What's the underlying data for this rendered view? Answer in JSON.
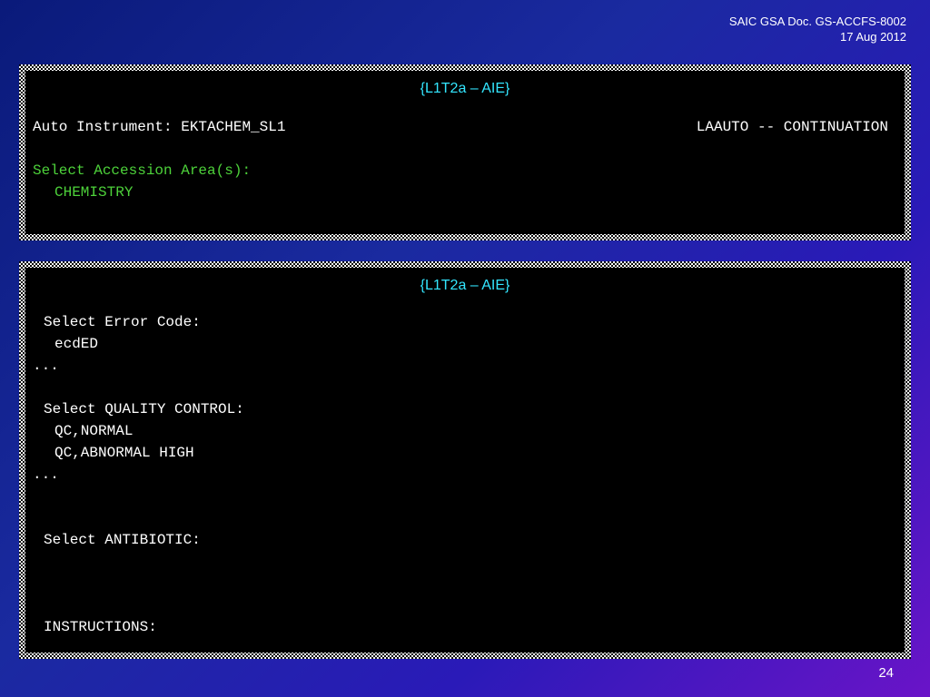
{
  "header": {
    "doc_id": "SAIC GSA Doc. GS-ACCFS-8002",
    "date": "17 Aug 2012"
  },
  "panel_top": {
    "title": "{L1T2a – AIE}",
    "instrument_line": "Auto Instrument: EKTACHEM_SL1",
    "mode_label": "LAAUTO -- CONTINUATION",
    "accession_prompt": "Select Accession Area(s):",
    "accession_value": "CHEMISTRY"
  },
  "panel_bottom": {
    "title": "{L1T2a – AIE}",
    "error_prompt": "Select Error Code:",
    "error_value": "ecdED",
    "ellipsis_1": "...",
    "qc_prompt": "Select QUALITY CONTROL:",
    "qc_values": [
      "QC,NORMAL",
      "QC,ABNORMAL HIGH"
    ],
    "ellipsis_2": "...",
    "antibiotic_prompt": "Select ANTIBIOTIC:",
    "instructions_prompt": "INSTRUCTIONS:"
  },
  "footer": {
    "page_number": "24"
  }
}
